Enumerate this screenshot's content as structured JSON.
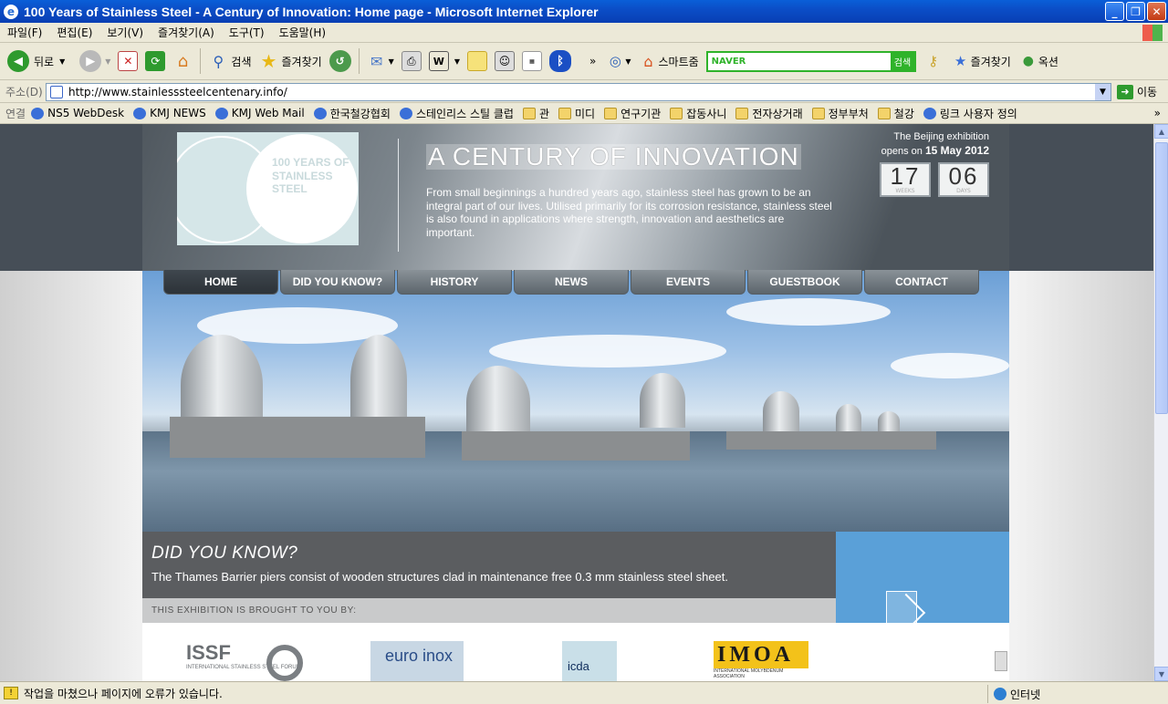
{
  "window": {
    "title": "100 Years of Stainless Steel - A Century of Innovation: Home page - Microsoft Internet Explorer",
    "minimize": "_",
    "restore": "❐",
    "close": "✕"
  },
  "menu": [
    "파일(F)",
    "편집(E)",
    "보기(V)",
    "즐겨찾기(A)",
    "도구(T)",
    "도움말(H)"
  ],
  "toolbar": {
    "back": "뒤로",
    "search": "검색",
    "favorites": "즐겨찾기",
    "smartzoom": "스마트줌",
    "naver_logo": "NAVER",
    "naver_go": "검색",
    "favorites2": "즐겨찾기",
    "options": "옥션",
    "more": "»"
  },
  "address": {
    "label": "주소(D)",
    "url": "http://www.stainlesssteelcentenary.info/",
    "go": "이동"
  },
  "links": {
    "label": "연결",
    "items": [
      {
        "label": "NS5 WebDesk",
        "icon": "ie-page-icon"
      },
      {
        "label": "KMJ NEWS",
        "icon": "ie-page-icon"
      },
      {
        "label": "KMJ Web Mail",
        "icon": "ie-page-icon"
      },
      {
        "label": "한국철강협회",
        "icon": "ie-page-icon"
      },
      {
        "label": "스테인리스 스틸 클럽",
        "icon": "ie-page-icon"
      },
      {
        "label": "관",
        "icon": "folder-icon"
      },
      {
        "label": "미디",
        "icon": "folder-icon"
      },
      {
        "label": "연구기관",
        "icon": "folder-icon"
      },
      {
        "label": "잡동사니",
        "icon": "folder-icon"
      },
      {
        "label": "전자상거래",
        "icon": "folder-icon"
      },
      {
        "label": "정부부처",
        "icon": "folder-icon"
      },
      {
        "label": "철강",
        "icon": "folder-icon"
      },
      {
        "label": "링크 사용자 정의",
        "icon": "ie-page-icon"
      }
    ],
    "more": "»"
  },
  "site": {
    "logo_text": "100 YEARS OF STAINLESS STEEL",
    "tagline": "A CENTURY OF INNOVATION",
    "intro": "From small beginnings a hundred years ago, stainless steel has grown to be an integral part of our lives. Utilised primarily for its corrosion resistance, stainless steel is also found in applications where strength, innovation and aesthetics are important.",
    "countdown": {
      "line1": "The Beijing exhibition",
      "line2_prefix": "opens on",
      "date": "15 May 2012",
      "weeks": "17",
      "weeks_label": "WEEKS",
      "days": "06",
      "days_label": "DAYS"
    },
    "nav": [
      "HOME",
      "DID YOU KNOW?",
      "HISTORY",
      "NEWS",
      "EVENTS",
      "GUESTBOOK",
      "CONTACT"
    ],
    "did_you_know": {
      "heading": "DID YOU KNOW?",
      "text": "The Thames Barrier piers consist of wooden structures clad in maintenance free 0.3 mm stainless steel sheet."
    },
    "brought_by": "THIS EXHIBITION IS BROUGHT TO YOU BY:",
    "sponsors": {
      "issf": "ISSF",
      "issf_sub": "INTERNATIONAL STAINLESS STEEL FORUM",
      "euro": "euro inox",
      "icda": "icda",
      "imoa": "IMOA",
      "imoa_sub": "INTERNATIONAL MOLYBDENUM ASSOCIATION"
    }
  },
  "status": {
    "text": "작업을 마쳤으나 페이지에 오류가 있습니다.",
    "zone": "인터넷"
  },
  "colors": {
    "title_bar": "#0b4ec7",
    "header_band": "#464e57",
    "did_you_know_bg": "#5b5d60",
    "blue_box": "#5aa0d8"
  }
}
